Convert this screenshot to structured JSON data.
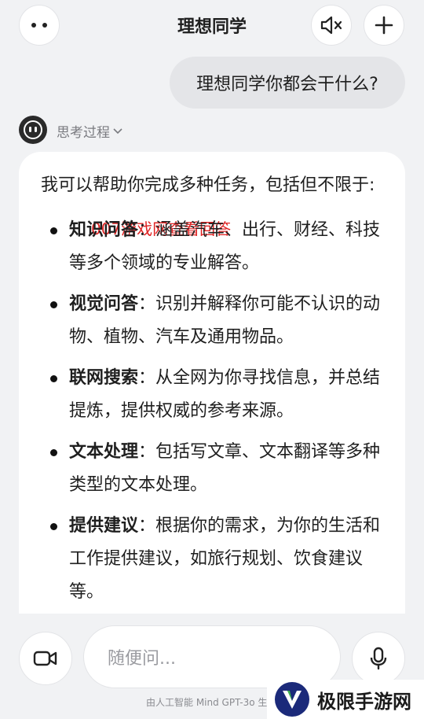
{
  "header": {
    "title": "理想同学"
  },
  "conversation": {
    "user_message": "理想同学你都会干什么?",
    "thinking_label": "思考过程",
    "answer_intro": "我可以帮助你完成多种任务，包括但不限于:",
    "watermark": "007游戏网查看回答",
    "items": [
      {
        "title": "知识问答",
        "text": "：涵盖汽车、出行、财经、科技等多个领域的专业解答。"
      },
      {
        "title": "视觉问答",
        "text": "：识别并解释你可能不认识的动物、植物、汽车及通用物品。"
      },
      {
        "title": "联网搜索",
        "text": "：从全网为你寻找信息，并总结提炼，提供权威的参考来源。"
      },
      {
        "title": "文本处理",
        "text": "：包括写文章、文本翻译等多种类型的文本处理。"
      },
      {
        "title": "提供建议",
        "text": "：根据你的需求，为你的生活和工作提供建议，如旅行规划、饮食建议等。"
      }
    ]
  },
  "input": {
    "placeholder": "随便问..."
  },
  "footer": {
    "text": "由人工智能 Mind GPT-3o 生"
  },
  "overlay_logo": {
    "text": "极限手游网"
  },
  "colors": {
    "background": "#f1f2f4",
    "watermark": "#e02424",
    "logo_blue": "#1b2a7a"
  }
}
